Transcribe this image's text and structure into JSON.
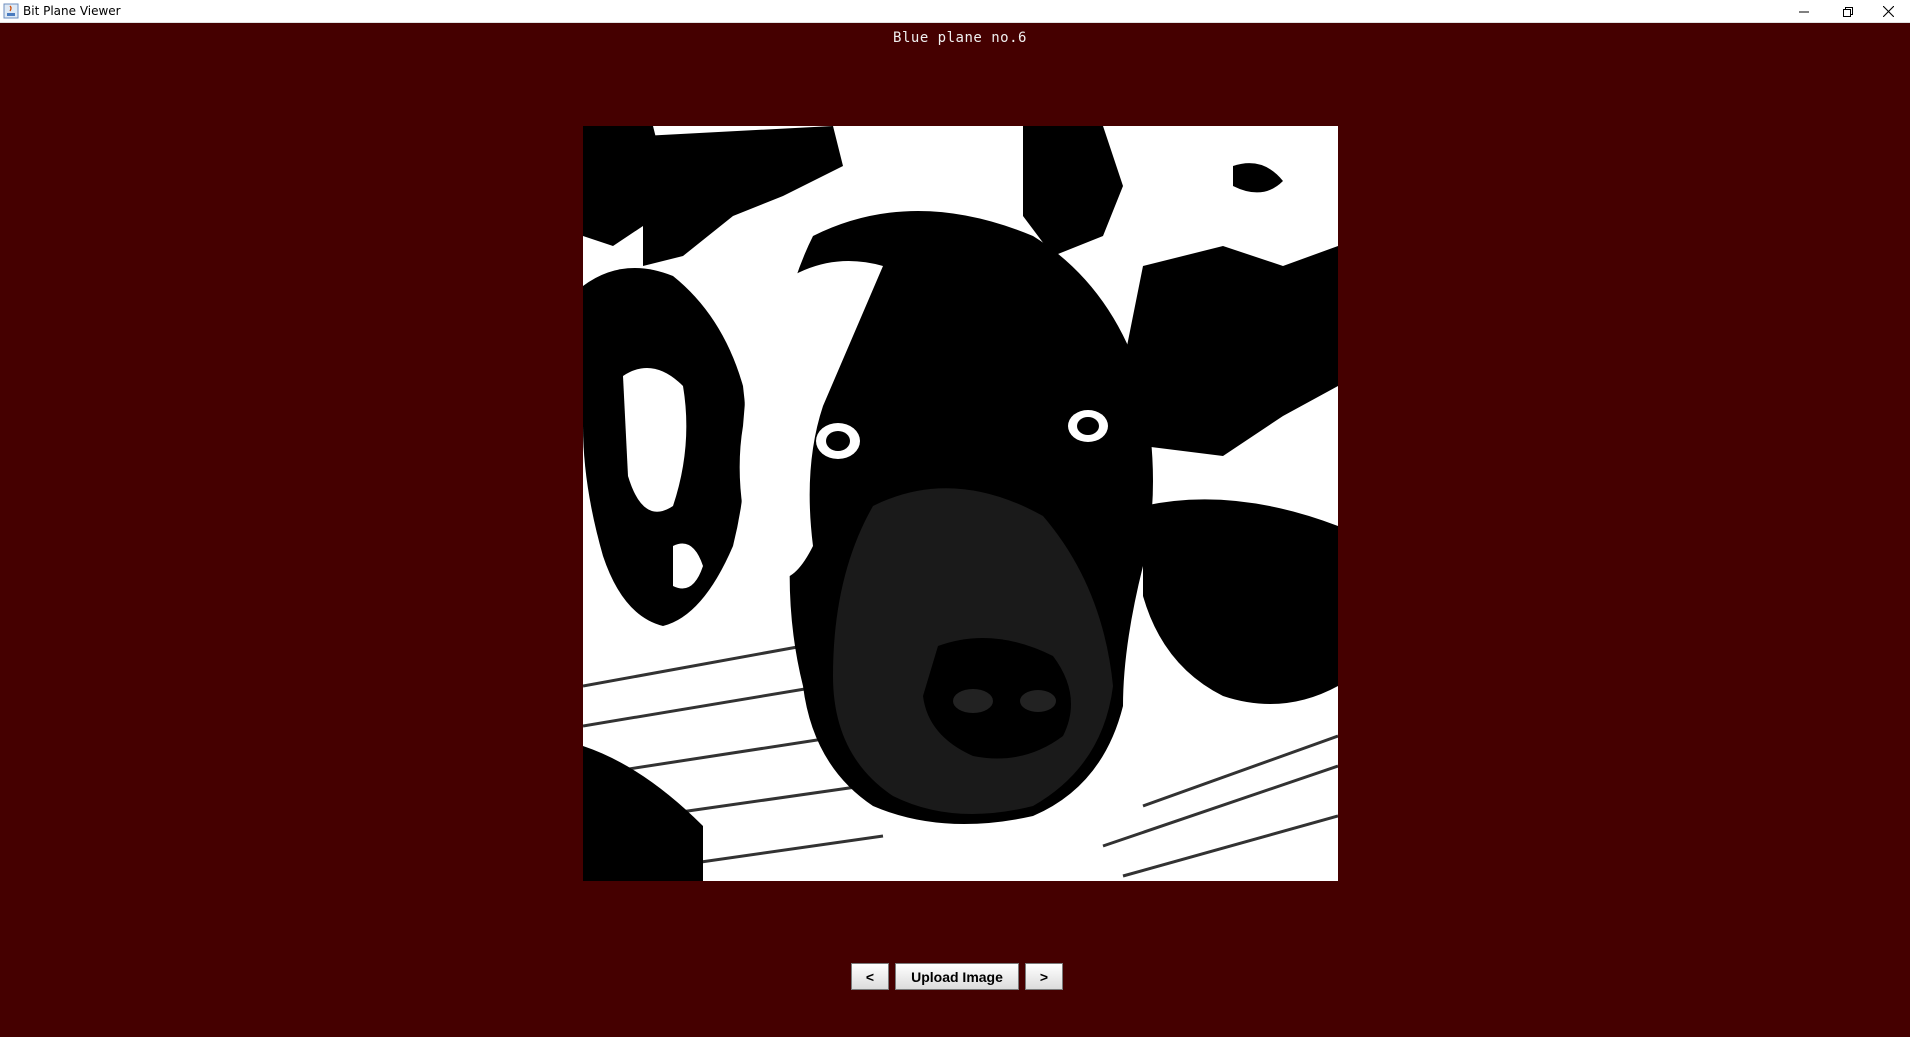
{
  "window": {
    "title": "Bit Plane Viewer"
  },
  "viewer": {
    "plane_label": "Blue plane no.6",
    "image_alt": "bit plane of dog photo"
  },
  "controls": {
    "prev_label": "<",
    "upload_label": "Upload Image",
    "next_label": ">"
  },
  "colors": {
    "background": "#450000",
    "plane_fg": "#000000",
    "plane_bg": "#ffffff"
  }
}
